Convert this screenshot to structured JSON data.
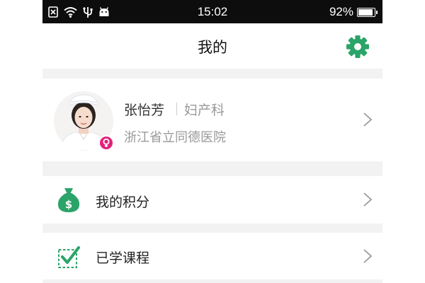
{
  "status_bar": {
    "time": "15:02",
    "battery_percent": "92%",
    "battery_level": 0.92,
    "icons": [
      "sim-off-icon",
      "wifi-icon",
      "usb-icon",
      "android-icon"
    ]
  },
  "header": {
    "title": "我的",
    "settings_icon": "gear-icon"
  },
  "profile": {
    "name": "张怡芳",
    "department": "妇产科",
    "hospital": "浙江省立同德医院",
    "gender_icon": "female-icon"
  },
  "menu": {
    "items": [
      {
        "label": "我的积分",
        "icon": "money-bag-icon"
      },
      {
        "label": "已学课程",
        "icon": "checklist-icon"
      }
    ]
  },
  "colors": {
    "accent_green": "#2aa468",
    "badge_pink": "#e3207a",
    "status_bar_bg": "#0d0d0d",
    "page_bg": "#f2f2f2"
  }
}
